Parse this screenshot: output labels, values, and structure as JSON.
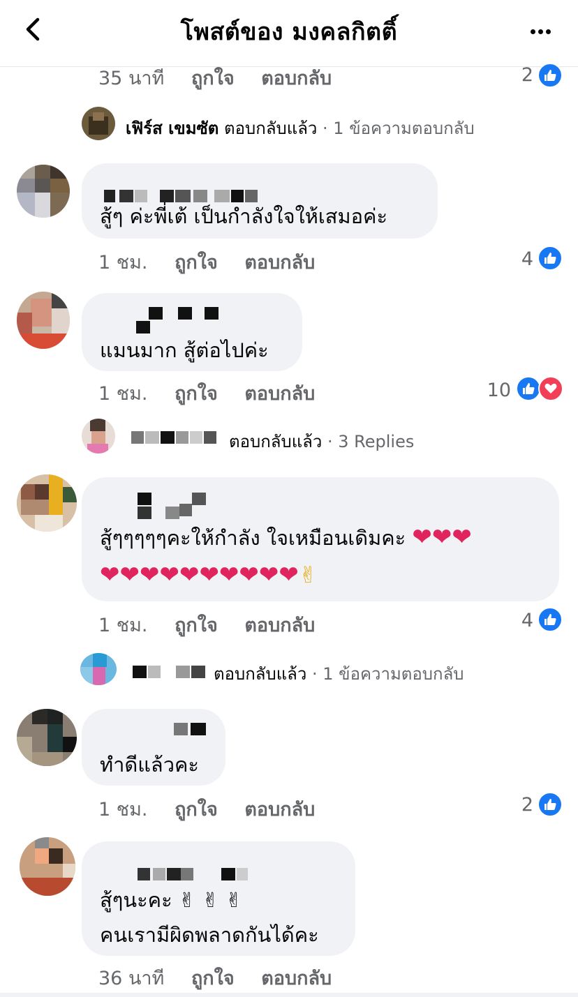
{
  "header": {
    "title": "โพสต์ของ มงคลกิตติ์"
  },
  "top_meta": {
    "time": "35 นาที",
    "like": "ถูกใจ",
    "reply": "ตอบกลับ",
    "count": "2"
  },
  "reply_summary_1": {
    "name": "เฟิร์ส เขมซัต",
    "action": "ตอบกลับแล้ว",
    "sub": "· 1 ข้อความตอบกลับ"
  },
  "comments": [
    {
      "text": "สู้ๆ ค่ะพี่เต้ เป็นกำลังใจให้เสมอค่ะ",
      "time": "1 ชม.",
      "like": "ถูกใจ",
      "reply": "ตอบกลับ",
      "count": "4"
    },
    {
      "text": "แมนมาก สู้ต่อไปค่ะ",
      "time": "1 ชม.",
      "like": "ถูกใจ",
      "reply": "ตอบกลับ",
      "count": "10"
    },
    {
      "text1": "สู้ๆๆๆๆๆคะให้กำลัง ใจเหมือนเดิมคะ",
      "text2": "✌",
      "time": "1 ชม.",
      "like": "ถูกใจ",
      "reply": "ตอบกลับ",
      "count": "4"
    },
    {
      "text": "ทำดีแล้วคะ",
      "time": "1 ชม.",
      "like": "ถูกใจ",
      "reply": "ตอบกลับ",
      "count": "2"
    },
    {
      "text1": "สู้ๆนะคะ ✌ ✌ ✌",
      "text2": "คนเรามีผิดพลาดกันได้คะ",
      "time": "36 นาที",
      "like": "ถูกใจ",
      "reply": "ตอบกลับ"
    }
  ],
  "reply_summary_2": {
    "action": "ตอบกลับแล้ว",
    "sub": "· 3 Replies"
  },
  "reply_summary_3": {
    "action": "ตอบกลับแล้ว",
    "sub": "· 1 ข้อความตอบกลับ"
  },
  "icons": {
    "back": "chevron-left-icon",
    "more": "more-dots-icon",
    "like": "like-thumb-icon",
    "love": "love-heart-icon"
  },
  "colors": {
    "like_blue": "#1877f2",
    "love_red": "#f33e58",
    "bubble_bg": "#f0f2f5",
    "meta_gray": "#65676b"
  }
}
